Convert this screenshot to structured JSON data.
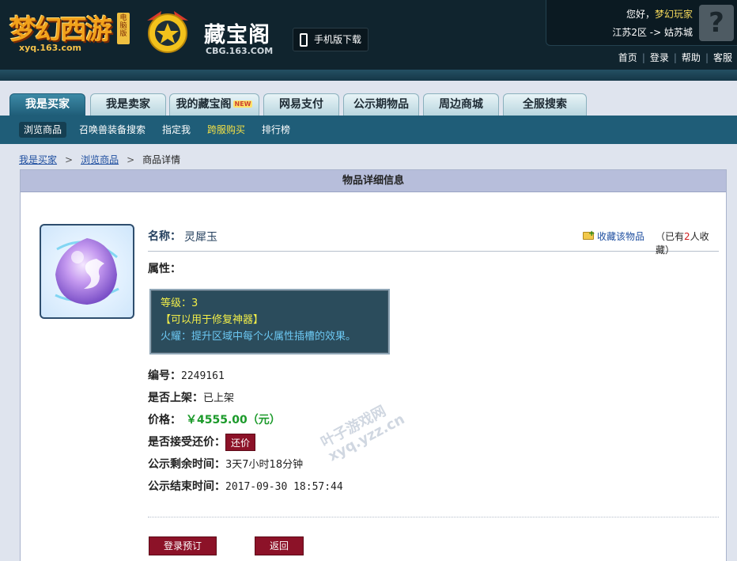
{
  "header": {
    "game_logo_text": "梦幻西游",
    "game_logo_badge": "电脑版",
    "game_logo_url": "xyq.163.com",
    "cbg_logo_name": "藏宝阁",
    "cbg_logo_domain": "CBG.163.COM",
    "mobile_download": "手机版下载",
    "greeting_prefix": "您好，",
    "username": "梦幻玩家",
    "server": "江苏2区 -> 姑苏城",
    "avatar_glyph": "?",
    "top_links": [
      "首页",
      "登录",
      "帮助",
      "客服"
    ]
  },
  "tabs": [
    {
      "label": "我是买家",
      "active": true
    },
    {
      "label": "我是卖家"
    },
    {
      "label": "我的藏宝阁",
      "badge": "NEW"
    },
    {
      "label": "网易支付"
    },
    {
      "label": "公示期物品"
    },
    {
      "label": "周边商城"
    },
    {
      "label": "全服搜索"
    }
  ],
  "subnav": [
    {
      "label": "浏览商品",
      "active": true
    },
    {
      "label": "召唤兽装备搜索"
    },
    {
      "label": "指定我"
    },
    {
      "label": "跨服购买",
      "highlight": true
    },
    {
      "label": "排行榜"
    }
  ],
  "breadcrumb": {
    "items": [
      "我是买家",
      "浏览商品"
    ],
    "arrow": ">",
    "current": "商品详情"
  },
  "panel": {
    "title": "物品详细信息",
    "name_label": "名称：",
    "name_value": "灵犀玉",
    "favorite_link": "收藏该物品",
    "favorite_count_prefix": "（已有",
    "favorite_count": "2",
    "favorite_count_suffix": "人收藏）",
    "attr_label": "属性：",
    "attr_level": "等级：3",
    "attr_special": "【可以用于修复神器】",
    "attr_effect": "火耀：提升区域中每个火属性插槽的效果。",
    "id_label": "编号：",
    "id_value": "2249161",
    "listed_label": "是否上架：",
    "listed_value": "已上架",
    "price_label": "价格：",
    "price_value": "￥4555.00（元）",
    "bargain_label": "是否接受还价：",
    "bargain_button": "还价",
    "remain_label": "公示剩余时间：",
    "remain_value": "3天7小时18分钟",
    "end_label": "公示结束时间：",
    "end_value": "2017-09-30 18:57:44",
    "preorder_button": "登录预订",
    "back_button": "返回"
  },
  "watermark": [
    "叶子游戏网",
    "xyq.yzz.cn"
  ],
  "colors": {
    "header_bg": "#10242e",
    "tab_active": "#1f5d78",
    "panel_title_bg": "#b7bedb",
    "attr_box_bg": "#2b4c5c",
    "price_green": "#1b9a2a",
    "button_red": "#8c1228",
    "link_blue": "#1f4fa0"
  }
}
